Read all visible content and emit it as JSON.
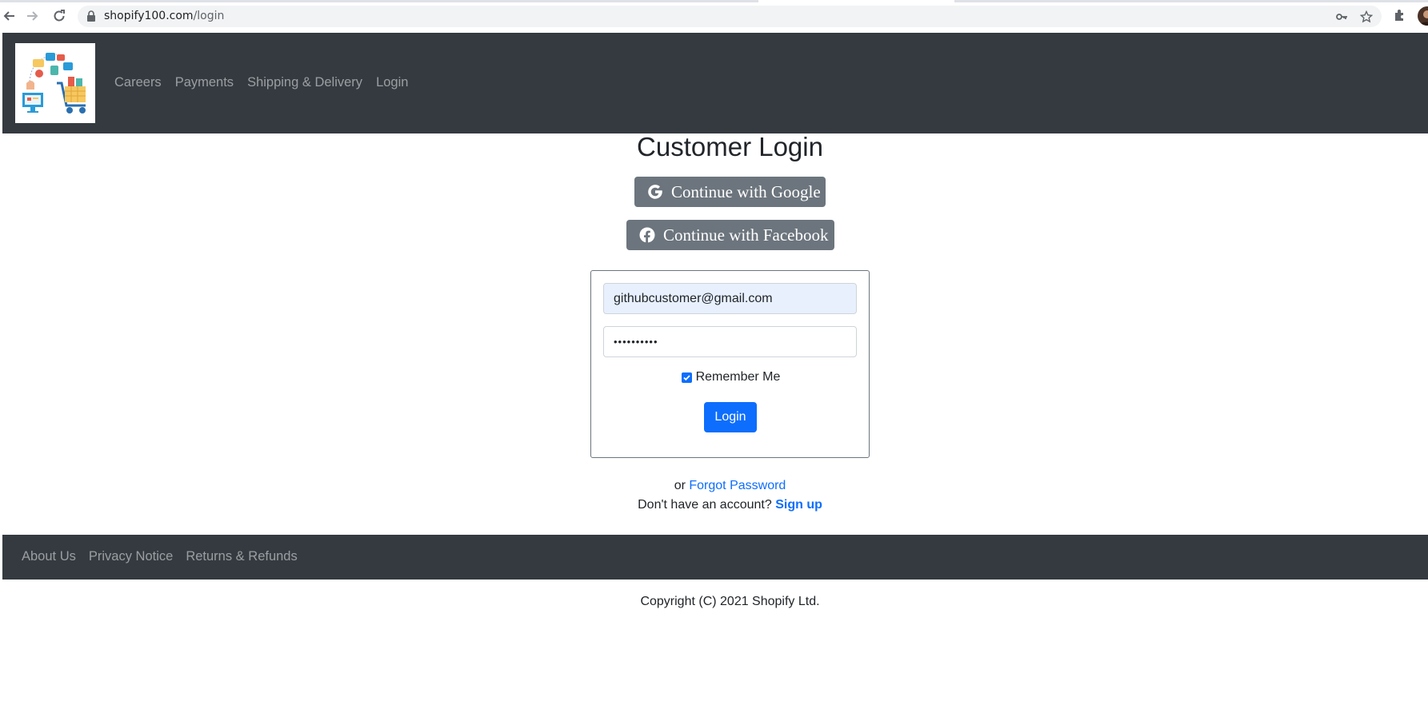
{
  "browser": {
    "url_host": "shopify100.com",
    "url_path": "/login"
  },
  "navbar": {
    "links": [
      "Careers",
      "Payments",
      "Shipping & Delivery",
      "Login"
    ]
  },
  "main": {
    "title": "Customer Login",
    "google_label": "Continue with Google",
    "facebook_label": "Continue with Facebook",
    "email_value": "githubcustomer@gmail.com",
    "password_value": "••••••••••",
    "remember_label": "Remember Me",
    "remember_checked": true,
    "login_label": "Login",
    "or_text": "or",
    "forgot_label": "Forgot Password",
    "no_account_text": "Don't have an account?",
    "signup_label": "Sign up"
  },
  "footer": {
    "links": [
      "About Us",
      "Privacy Notice",
      "Returns & Refunds"
    ],
    "copyright": "Copyright (C) 2021 Shopify Ltd."
  },
  "colors": {
    "dark": "#343a40",
    "primary": "#0d6efd",
    "secondary": "#6c757d",
    "autofill": "#e8f0fe"
  }
}
